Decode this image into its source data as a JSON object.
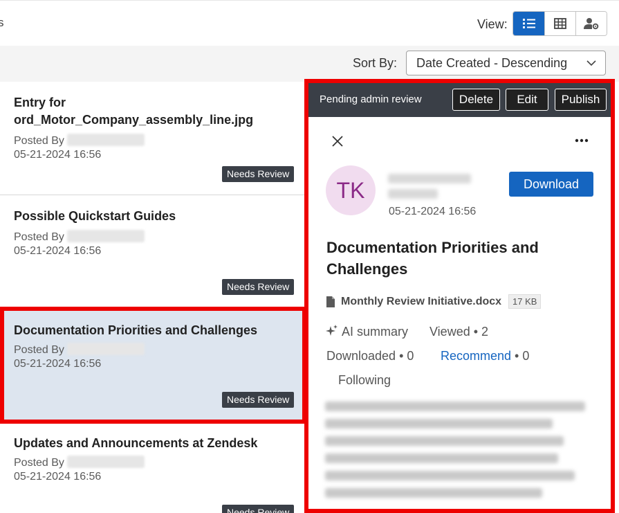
{
  "topbar": {
    "cut_text": "s",
    "view_label": "View:",
    "view_buttons": [
      {
        "icon": "list-view-icon",
        "active": true
      },
      {
        "icon": "grid-view-icon",
        "active": false
      },
      {
        "icon": "user-settings-icon",
        "active": false
      }
    ]
  },
  "sort": {
    "label": "Sort By:",
    "selected": "Date Created - Descending"
  },
  "entries": [
    {
      "title": "Entry for ord_Motor_Company_assembly_line.jpg",
      "posted_by": "Posted By",
      "date": "05-21-2024 16:56",
      "badge": "Needs Review"
    },
    {
      "title": "Possible Quickstart Guides",
      "posted_by": "Posted By",
      "date": "05-21-2024 16:56",
      "badge": "Needs Review"
    },
    {
      "title": "Documentation Priorities and Challenges",
      "posted_by": "Posted By",
      "date": "05-21-2024 16:56",
      "badge": "Needs Review"
    },
    {
      "title": "Updates and Announcements at Zendesk",
      "posted_by": "Posted By",
      "date": "05-21-2024 16:56",
      "badge": "Needs Review"
    }
  ],
  "detail": {
    "status": "Pending admin review",
    "delete_label": "Delete",
    "edit_label": "Edit",
    "publish_label": "Publish",
    "avatar_initials": "TK",
    "date": "05-21-2024 16:56",
    "download_label": "Download",
    "title": "Documentation Priorities and Challenges",
    "file_name": "Monthly Review Initiative.docx",
    "file_size": "17 KB",
    "ai_summary": "AI summary",
    "viewed": "Viewed • 2",
    "downloaded": "Downloaded • 0",
    "recommend": "Recommend",
    "recommend_count": " • 0",
    "following": "Following"
  },
  "colors": {
    "accent": "#1565c0",
    "highlight": "#ee0000",
    "badge": "#3a3f47",
    "selected_row": "#dde5ef"
  }
}
